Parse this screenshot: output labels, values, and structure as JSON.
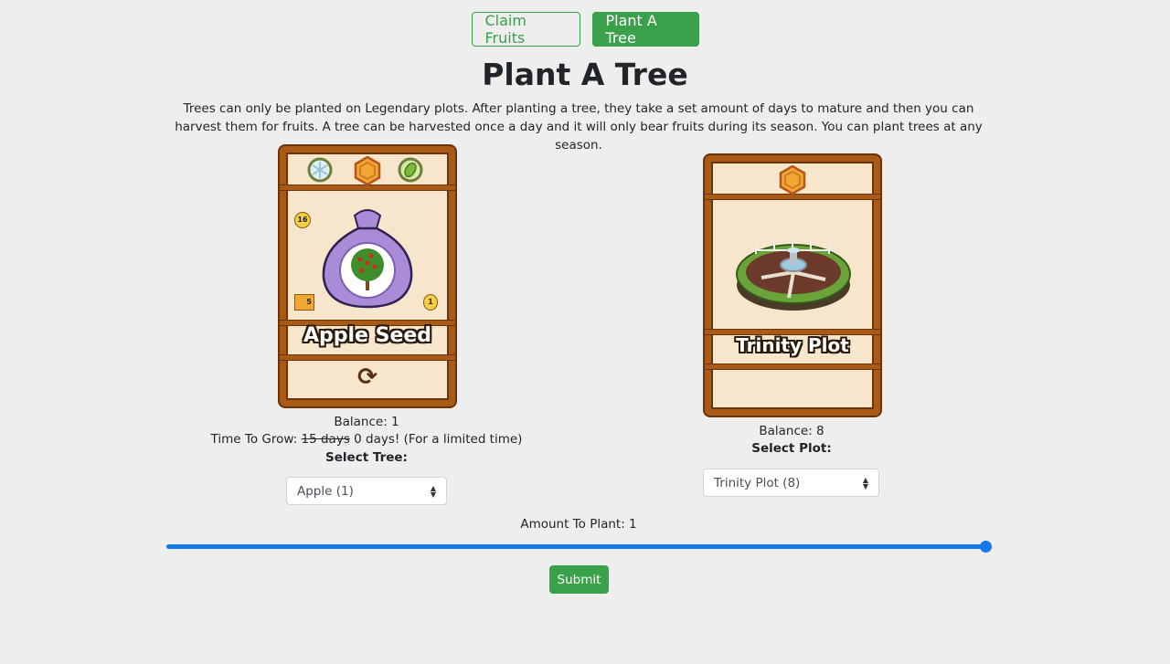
{
  "nav": {
    "claim_label": "Claim Fruits",
    "plant_label": "Plant A Tree",
    "accent_color": "#3aa14b"
  },
  "page": {
    "title": "Plant A Tree",
    "intro": "Trees can only be planted on Legendary plots. After planting a tree, they take a set amount of days to mature and then you can harvest them for fruits. A tree can be harvested once a day and it will only bear fruits during its season. You can plant trees at any season."
  },
  "seed_card": {
    "name": "Apple Seed",
    "badge_top_left": "16",
    "badge_box": "5",
    "badge_right": "1",
    "icons": [
      "snowflake-icon",
      "hexagon-rarity-icon",
      "leaf-icon",
      "refresh-icon"
    ]
  },
  "plot_card": {
    "name": "Trinity Plot",
    "icons": [
      "hexagon-rarity-icon",
      "fountain-garden-icon"
    ]
  },
  "tree": {
    "balance_label": "Balance: 1",
    "grow_prefix": "Time To Grow:",
    "grow_old": "15 days",
    "grow_new": "0 days! (For a limited time)",
    "select_label": "Select Tree:",
    "selected": "Apple (1)"
  },
  "plot": {
    "balance_label": "Balance: 8",
    "select_label": "Select Plot:",
    "selected": "Trinity Plot (8)"
  },
  "amount": {
    "label": "Amount To Plant: 1",
    "value": 1,
    "slider_fraction": 1.0,
    "slider_color": "#1877e8"
  },
  "submit_label": "Submit"
}
